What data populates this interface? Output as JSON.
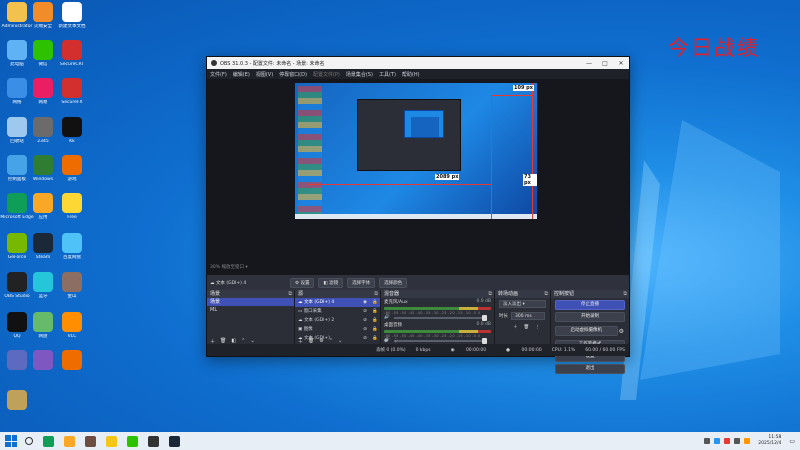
{
  "desktop": {
    "watermark": "今日战绩",
    "icons": [
      {
        "label": "Administrator",
        "color": "#f2c14e"
      },
      {
        "label": "火绒安全",
        "color": "#f28c28"
      },
      {
        "label": "新建文本文档",
        "color": "#ffffff"
      },
      {
        "label": "此电脑",
        "color": "#5fb3f5"
      },
      {
        "label": "微信",
        "color": "#2dc100"
      },
      {
        "label": "SecureCRT",
        "color": "#d32f2f"
      },
      {
        "label": "网络",
        "color": "#3a8ee6"
      },
      {
        "label": "网易",
        "color": "#e91e63"
      },
      {
        "label": "SecureFX",
        "color": "#d32f2f"
      },
      {
        "label": "回收站",
        "color": "#9ec9ef"
      },
      {
        "label": "2345",
        "color": "#6b6b6b"
      },
      {
        "label": "Kk",
        "color": "#111111"
      },
      {
        "label": "控制面板",
        "color": "#47a3e8"
      },
      {
        "label": "Windows",
        "color": "#2e7d32"
      },
      {
        "label": "游戏",
        "color": "#ef6c00"
      },
      {
        "label": "Microsoft Edge",
        "color": "#0f9d58"
      },
      {
        "label": "应用",
        "color": "#f9a825"
      },
      {
        "label": "Free",
        "color": "#fdd835"
      },
      {
        "label": "GeForce",
        "color": "#76b900"
      },
      {
        "label": "Steam",
        "color": "#1b2838"
      },
      {
        "label": "百度网盘",
        "color": "#4fc3f7"
      },
      {
        "label": "OBS Studio",
        "color": "#222222"
      },
      {
        "label": "蓝牙",
        "color": "#26c6da"
      },
      {
        "label": "金山",
        "color": "#8d6e63"
      },
      {
        "label": "QQ",
        "color": "#111111"
      },
      {
        "label": "网盘",
        "color": "#66bb6a"
      },
      {
        "label": "VLC",
        "color": "#ff8f00"
      },
      {
        "label": "",
        "color": "#5c6bc0"
      },
      {
        "label": "",
        "color": "#7e57c2"
      },
      {
        "label": "",
        "color": "#ef6c00"
      },
      {
        "label": "",
        "color": "#c0a15a"
      }
    ]
  },
  "obs": {
    "title": "OBS 31.0.3 - 配置文件: 未命名 - 场景: 未命名",
    "menu": [
      "文件(F)",
      "编辑(E)",
      "视图(V)",
      "停靠窗口(D)",
      "配置文件(P)",
      "场景集合(S)",
      "工具(T)",
      "帮助(H)"
    ],
    "preview": {
      "measure_top": "109 px",
      "measure_right": "73 px",
      "measure_left": "2089 px",
      "zoom_label": "30%",
      "zoom_note": "缩放至窗口"
    },
    "source_toolbar": {
      "current_source": "文本 (GDI+) 4",
      "buttons": [
        "设置",
        "滤镜",
        "选择字体",
        "选择颜色"
      ]
    },
    "scenes": {
      "header": "场景",
      "items": [
        "场景",
        "ML"
      ]
    },
    "sources": {
      "header": "源",
      "items": [
        "文本 (GDI+) 4",
        "窗口采集",
        "文本 (GDI+) 2",
        "图像",
        "文本 (GDI+)",
        "显示器采集"
      ]
    },
    "mixer": {
      "header": "混音器",
      "channels": [
        {
          "name": "麦克风/Aux",
          "db": "0.0 dB"
        },
        {
          "name": "桌面音频",
          "db": "0.0 dB"
        }
      ],
      "ticks": "-60 -55 -50 -45 -40 -35 -30 -25 -20 -15 -10 -5 0"
    },
    "transitions": {
      "header": "转场动画",
      "type": "淡入淡出",
      "duration_label": "时长",
      "duration": "300 ms"
    },
    "controls": {
      "header": "控制按钮",
      "buttons": [
        "停止直播",
        "开始录制",
        "启动虚拟摄像机",
        "工作室模式",
        "设置",
        "退出"
      ]
    },
    "status": {
      "dropped": "丢帧 0 (0.0%)",
      "kbps": "0 kbps",
      "time1": "00:00:00",
      "time2": "00:00:00",
      "cpu": "CPU: 1.1%",
      "fps": "60.00 / 60.00 FPS"
    }
  },
  "taskbar": {
    "time": "11:58",
    "date": "2025/12/4"
  }
}
